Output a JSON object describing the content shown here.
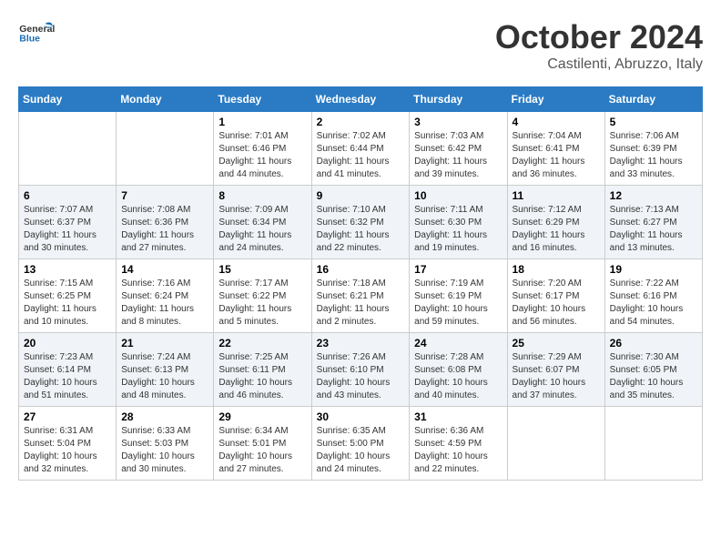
{
  "header": {
    "logo_general": "General",
    "logo_blue": "Blue",
    "month": "October 2024",
    "location": "Castilenti, Abruzzo, Italy"
  },
  "days_of_week": [
    "Sunday",
    "Monday",
    "Tuesday",
    "Wednesday",
    "Thursday",
    "Friday",
    "Saturday"
  ],
  "weeks": [
    [
      {
        "day": "",
        "sunrise": "",
        "sunset": "",
        "daylight": ""
      },
      {
        "day": "",
        "sunrise": "",
        "sunset": "",
        "daylight": ""
      },
      {
        "day": "1",
        "sunrise": "Sunrise: 7:01 AM",
        "sunset": "Sunset: 6:46 PM",
        "daylight": "Daylight: 11 hours and 44 minutes."
      },
      {
        "day": "2",
        "sunrise": "Sunrise: 7:02 AM",
        "sunset": "Sunset: 6:44 PM",
        "daylight": "Daylight: 11 hours and 41 minutes."
      },
      {
        "day": "3",
        "sunrise": "Sunrise: 7:03 AM",
        "sunset": "Sunset: 6:42 PM",
        "daylight": "Daylight: 11 hours and 39 minutes."
      },
      {
        "day": "4",
        "sunrise": "Sunrise: 7:04 AM",
        "sunset": "Sunset: 6:41 PM",
        "daylight": "Daylight: 11 hours and 36 minutes."
      },
      {
        "day": "5",
        "sunrise": "Sunrise: 7:06 AM",
        "sunset": "Sunset: 6:39 PM",
        "daylight": "Daylight: 11 hours and 33 minutes."
      }
    ],
    [
      {
        "day": "6",
        "sunrise": "Sunrise: 7:07 AM",
        "sunset": "Sunset: 6:37 PM",
        "daylight": "Daylight: 11 hours and 30 minutes."
      },
      {
        "day": "7",
        "sunrise": "Sunrise: 7:08 AM",
        "sunset": "Sunset: 6:36 PM",
        "daylight": "Daylight: 11 hours and 27 minutes."
      },
      {
        "day": "8",
        "sunrise": "Sunrise: 7:09 AM",
        "sunset": "Sunset: 6:34 PM",
        "daylight": "Daylight: 11 hours and 24 minutes."
      },
      {
        "day": "9",
        "sunrise": "Sunrise: 7:10 AM",
        "sunset": "Sunset: 6:32 PM",
        "daylight": "Daylight: 11 hours and 22 minutes."
      },
      {
        "day": "10",
        "sunrise": "Sunrise: 7:11 AM",
        "sunset": "Sunset: 6:30 PM",
        "daylight": "Daylight: 11 hours and 19 minutes."
      },
      {
        "day": "11",
        "sunrise": "Sunrise: 7:12 AM",
        "sunset": "Sunset: 6:29 PM",
        "daylight": "Daylight: 11 hours and 16 minutes."
      },
      {
        "day": "12",
        "sunrise": "Sunrise: 7:13 AM",
        "sunset": "Sunset: 6:27 PM",
        "daylight": "Daylight: 11 hours and 13 minutes."
      }
    ],
    [
      {
        "day": "13",
        "sunrise": "Sunrise: 7:15 AM",
        "sunset": "Sunset: 6:25 PM",
        "daylight": "Daylight: 11 hours and 10 minutes."
      },
      {
        "day": "14",
        "sunrise": "Sunrise: 7:16 AM",
        "sunset": "Sunset: 6:24 PM",
        "daylight": "Daylight: 11 hours and 8 minutes."
      },
      {
        "day": "15",
        "sunrise": "Sunrise: 7:17 AM",
        "sunset": "Sunset: 6:22 PM",
        "daylight": "Daylight: 11 hours and 5 minutes."
      },
      {
        "day": "16",
        "sunrise": "Sunrise: 7:18 AM",
        "sunset": "Sunset: 6:21 PM",
        "daylight": "Daylight: 11 hours and 2 minutes."
      },
      {
        "day": "17",
        "sunrise": "Sunrise: 7:19 AM",
        "sunset": "Sunset: 6:19 PM",
        "daylight": "Daylight: 10 hours and 59 minutes."
      },
      {
        "day": "18",
        "sunrise": "Sunrise: 7:20 AM",
        "sunset": "Sunset: 6:17 PM",
        "daylight": "Daylight: 10 hours and 56 minutes."
      },
      {
        "day": "19",
        "sunrise": "Sunrise: 7:22 AM",
        "sunset": "Sunset: 6:16 PM",
        "daylight": "Daylight: 10 hours and 54 minutes."
      }
    ],
    [
      {
        "day": "20",
        "sunrise": "Sunrise: 7:23 AM",
        "sunset": "Sunset: 6:14 PM",
        "daylight": "Daylight: 10 hours and 51 minutes."
      },
      {
        "day": "21",
        "sunrise": "Sunrise: 7:24 AM",
        "sunset": "Sunset: 6:13 PM",
        "daylight": "Daylight: 10 hours and 48 minutes."
      },
      {
        "day": "22",
        "sunrise": "Sunrise: 7:25 AM",
        "sunset": "Sunset: 6:11 PM",
        "daylight": "Daylight: 10 hours and 46 minutes."
      },
      {
        "day": "23",
        "sunrise": "Sunrise: 7:26 AM",
        "sunset": "Sunset: 6:10 PM",
        "daylight": "Daylight: 10 hours and 43 minutes."
      },
      {
        "day": "24",
        "sunrise": "Sunrise: 7:28 AM",
        "sunset": "Sunset: 6:08 PM",
        "daylight": "Daylight: 10 hours and 40 minutes."
      },
      {
        "day": "25",
        "sunrise": "Sunrise: 7:29 AM",
        "sunset": "Sunset: 6:07 PM",
        "daylight": "Daylight: 10 hours and 37 minutes."
      },
      {
        "day": "26",
        "sunrise": "Sunrise: 7:30 AM",
        "sunset": "Sunset: 6:05 PM",
        "daylight": "Daylight: 10 hours and 35 minutes."
      }
    ],
    [
      {
        "day": "27",
        "sunrise": "Sunrise: 6:31 AM",
        "sunset": "Sunset: 5:04 PM",
        "daylight": "Daylight: 10 hours and 32 minutes."
      },
      {
        "day": "28",
        "sunrise": "Sunrise: 6:33 AM",
        "sunset": "Sunset: 5:03 PM",
        "daylight": "Daylight: 10 hours and 30 minutes."
      },
      {
        "day": "29",
        "sunrise": "Sunrise: 6:34 AM",
        "sunset": "Sunset: 5:01 PM",
        "daylight": "Daylight: 10 hours and 27 minutes."
      },
      {
        "day": "30",
        "sunrise": "Sunrise: 6:35 AM",
        "sunset": "Sunset: 5:00 PM",
        "daylight": "Daylight: 10 hours and 24 minutes."
      },
      {
        "day": "31",
        "sunrise": "Sunrise: 6:36 AM",
        "sunset": "Sunset: 4:59 PM",
        "daylight": "Daylight: 10 hours and 22 minutes."
      },
      {
        "day": "",
        "sunrise": "",
        "sunset": "",
        "daylight": ""
      },
      {
        "day": "",
        "sunrise": "",
        "sunset": "",
        "daylight": ""
      }
    ]
  ]
}
